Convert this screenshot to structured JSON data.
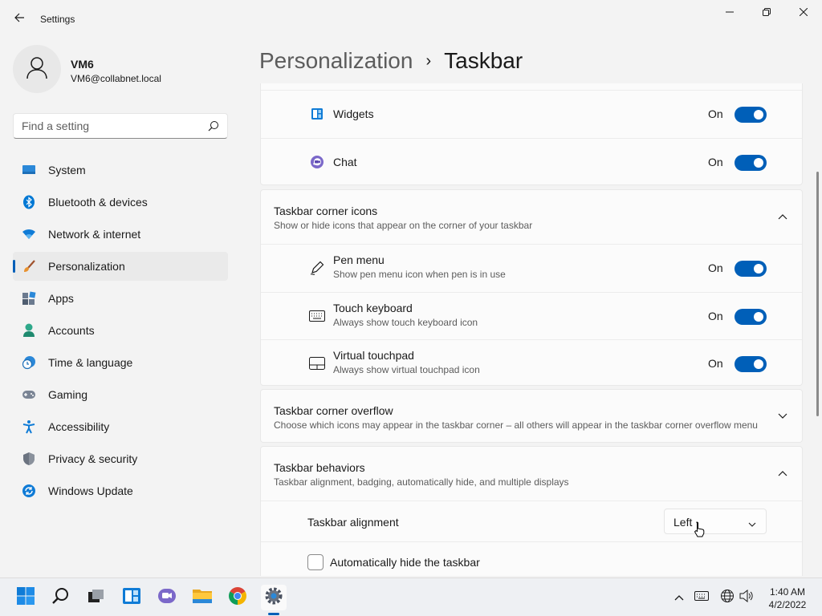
{
  "window": {
    "title": "Settings"
  },
  "profile": {
    "name": "VM6",
    "email": "VM6@collabnet.local"
  },
  "search": {
    "placeholder": "Find a setting"
  },
  "sidebar": {
    "items": [
      {
        "label": "System",
        "icon": "system-icon"
      },
      {
        "label": "Bluetooth & devices",
        "icon": "bluetooth-icon"
      },
      {
        "label": "Network & internet",
        "icon": "wifi-icon"
      },
      {
        "label": "Personalization",
        "icon": "brush-icon",
        "active": true
      },
      {
        "label": "Apps",
        "icon": "apps-icon"
      },
      {
        "label": "Accounts",
        "icon": "account-icon"
      },
      {
        "label": "Time & language",
        "icon": "clock-globe-icon"
      },
      {
        "label": "Gaming",
        "icon": "gamepad-icon"
      },
      {
        "label": "Accessibility",
        "icon": "accessibility-icon"
      },
      {
        "label": "Privacy & security",
        "icon": "shield-icon"
      },
      {
        "label": "Windows Update",
        "icon": "update-icon"
      }
    ]
  },
  "breadcrumb": {
    "parent": "Personalization",
    "separator": "›",
    "current": "Taskbar"
  },
  "taskbar_items": {
    "widgets": {
      "label": "Widgets",
      "state": "On"
    },
    "chat": {
      "label": "Chat",
      "state": "On"
    }
  },
  "corner_icons": {
    "title": "Taskbar corner icons",
    "description": "Show or hide icons that appear on the corner of your taskbar",
    "items": [
      {
        "label": "Pen menu",
        "description": "Show pen menu icon when pen is in use",
        "state": "On"
      },
      {
        "label": "Touch keyboard",
        "description": "Always show touch keyboard icon",
        "state": "On"
      },
      {
        "label": "Virtual touchpad",
        "description": "Always show virtual touchpad icon",
        "state": "On"
      }
    ]
  },
  "corner_overflow": {
    "title": "Taskbar corner overflow",
    "description": "Choose which icons may appear in the taskbar corner – all others will appear in the taskbar corner overflow menu"
  },
  "behaviors": {
    "title": "Taskbar behaviors",
    "description": "Taskbar alignment, badging, automatically hide, and multiple displays",
    "alignment_label": "Taskbar alignment",
    "alignment_value": "Left",
    "autohide_label": "Automatically hide the taskbar",
    "autohide_checked": false
  },
  "clock": {
    "time": "1:40 AM",
    "date": "4/2/2022"
  },
  "colors": {
    "accent": "#005fb8",
    "background": "#f3f3f3",
    "card": "#fbfbfb"
  }
}
